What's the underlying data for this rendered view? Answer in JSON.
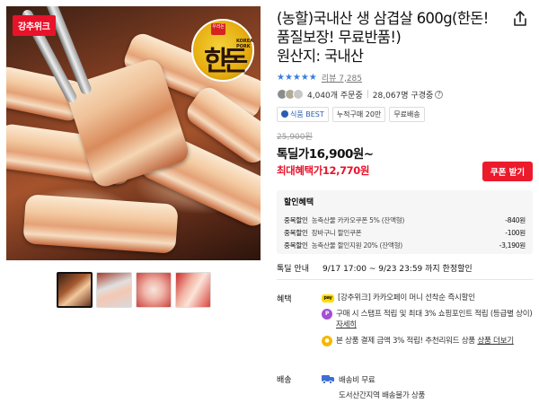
{
  "image": {
    "badge": "강추위크",
    "brand_seal": "우리돈",
    "brand_text": "한돈",
    "brand_sub": "KOREA PORK"
  },
  "product": {
    "title": "(농할)국내산 생 삼겹살 600g(한돈!품질보장! 무료반품!)",
    "origin": "원산지: 국내산",
    "stars": "★★★★★",
    "review_link": "리뷰 7,285",
    "buyers_count": "4,040개 주문중",
    "likes_count": "28,067명 구경중",
    "tags": [
      "식품 BEST",
      "누적구매 20만",
      "무료배송"
    ],
    "original_price": "25,900원",
    "special_label": "톡딜가",
    "special_price": "16,900원~",
    "max_label": "최대혜택가",
    "max_price": "12,770원",
    "coupon_button": "쿠폰 받기"
  },
  "discount": {
    "heading": "할인혜택",
    "rows": [
      {
        "name": "중복할인",
        "desc": "농축산물 카카오쿠폰 5% (잔액형)",
        "amount": "-840원"
      },
      {
        "name": "중복할인",
        "desc": "장바구니 할인쿠폰",
        "amount": "-100원"
      },
      {
        "name": "중복할인",
        "desc": "농축산물 할인지원 20% (잔액형)",
        "amount": "-3,190원"
      }
    ]
  },
  "sale": {
    "label": "톡딜 안내",
    "value": "9/17 17:00 ~ 9/23 23:59 까지 한정할인"
  },
  "benefit": {
    "label": "혜택",
    "pay_icon": "pay",
    "item1": "[강추위크] 카카오페이 머니 선착순 즉시할인",
    "item2_pre": "구매 시 스탬프 적립 및 최대 3% 쇼핑포인트 적립 (등급별 상이) ",
    "item2_link": "자세히",
    "item3_pre": "본 상품 결제 금액 3% 적립! 추천리워드 상품 ",
    "item3_link": "상품 더보기"
  },
  "shipping": {
    "label": "배송",
    "fee": "배송비 무료",
    "note": "도서산간지역 배송불가 상품"
  },
  "colors": {
    "accent_red": "#e8132a",
    "star_blue": "#3b7dd8"
  }
}
